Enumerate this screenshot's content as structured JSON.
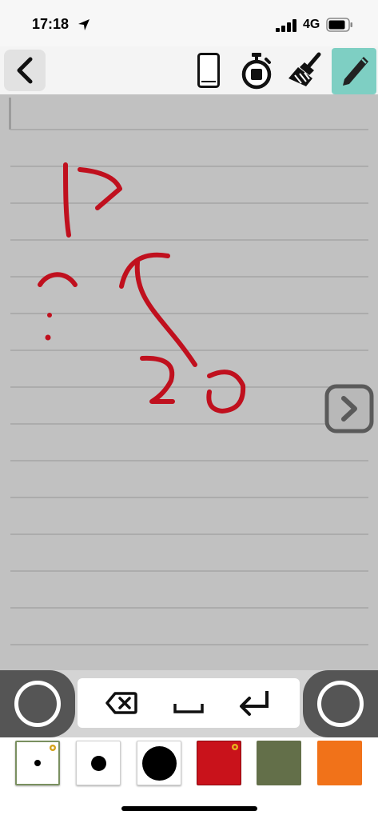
{
  "status_bar": {
    "time": "17:18",
    "network": "4G",
    "icons": [
      "location-arrow-icon",
      "signal-bars-icon",
      "battery-icon"
    ]
  },
  "toolbar": {
    "buttons": [
      "back-chevron-icon",
      "phone-icon",
      "stopwatch-icon",
      "broom-icon",
      "pencil-icon"
    ],
    "active_tool": "pencil",
    "active_color": "#7ecfc3"
  },
  "canvas": {
    "background": "#c1c1c1",
    "rule_line_color": "#a5a5a5",
    "ink_color": "#c0101e",
    "handwriting": [
      "13",
      "?",
      "20"
    ],
    "next_button_icon": "chevron-right-icon"
  },
  "keys": {
    "left_button_icon": "circle-icon",
    "right_button_icon": "circle-icon",
    "items": [
      "backspace-icon",
      "space-icon",
      "return-icon"
    ]
  },
  "palette": {
    "pen_sizes": [
      "small",
      "medium",
      "large"
    ],
    "selected_pen_size": "small",
    "colors": [
      "#c9121b",
      "#636f49",
      "#f17219"
    ],
    "selected_color": "#c9121b"
  }
}
